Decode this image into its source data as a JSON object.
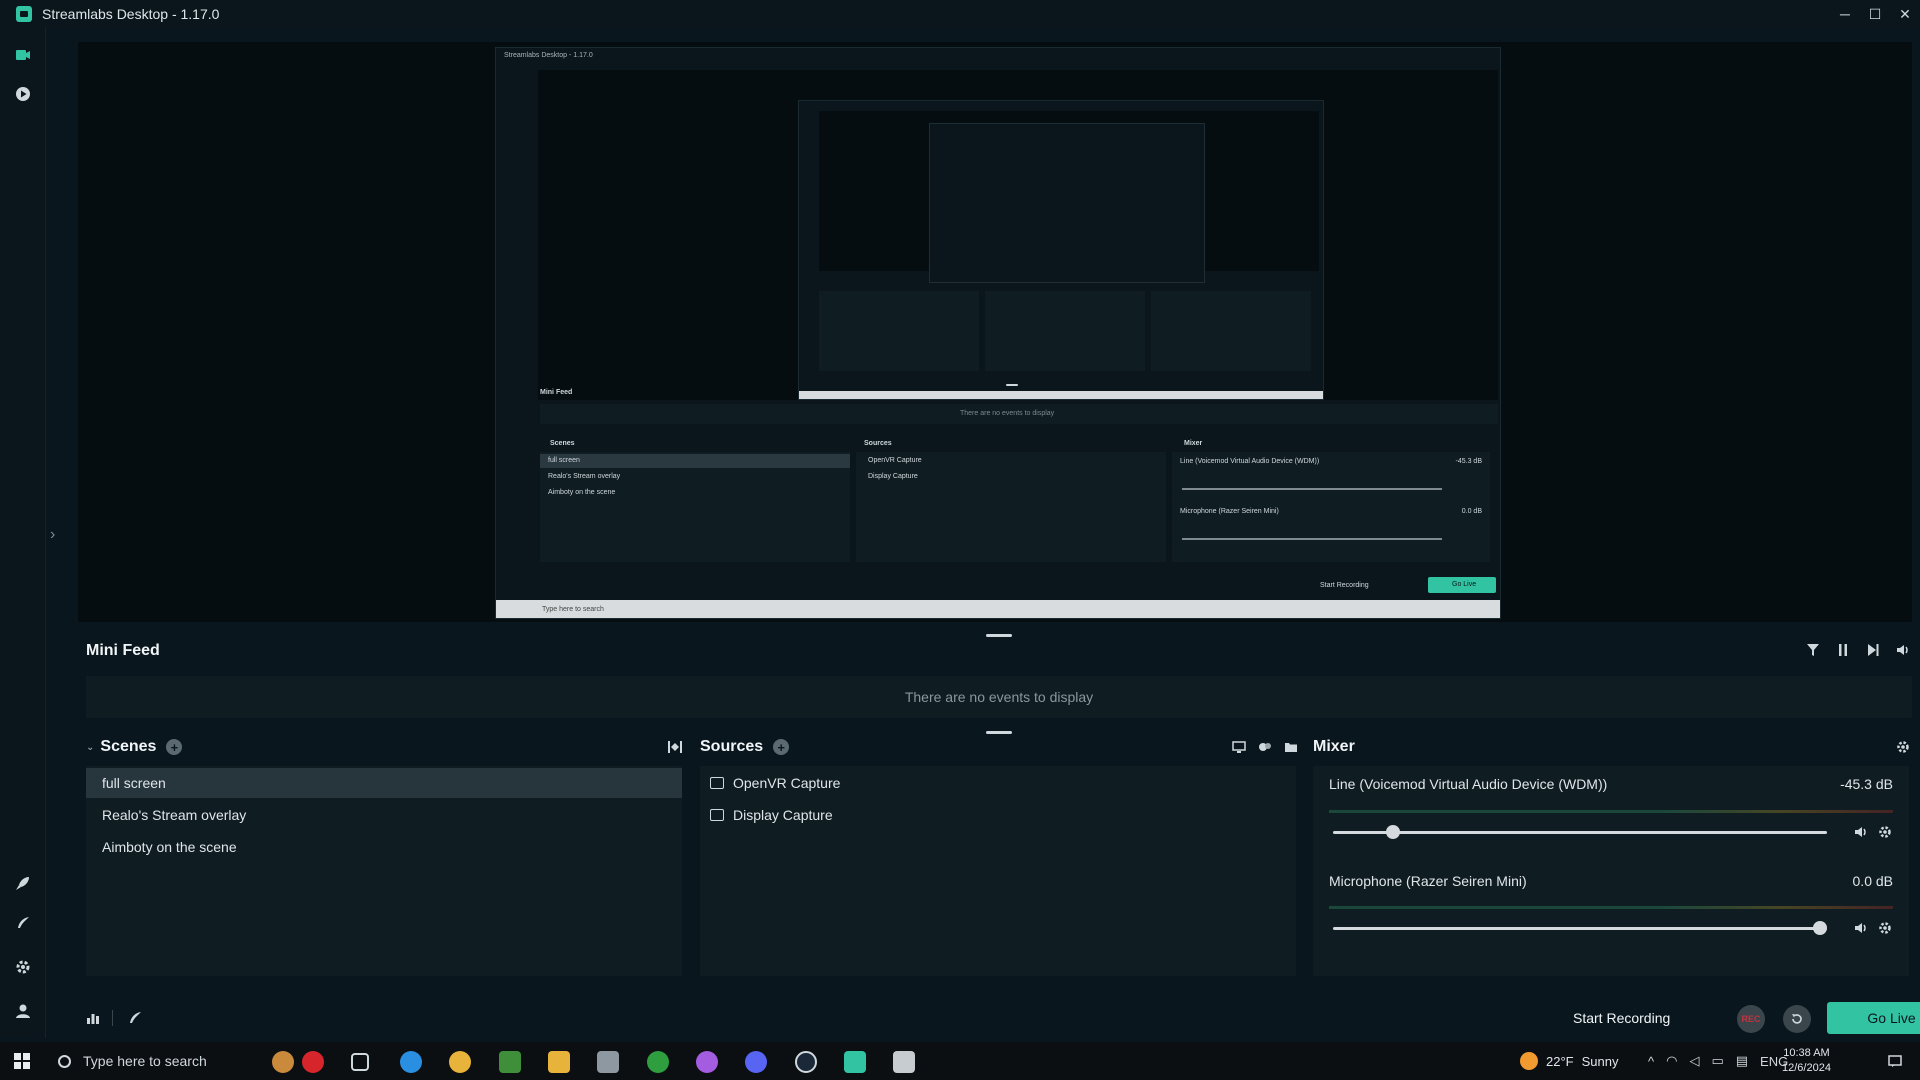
{
  "window": {
    "title": "Streamlabs Desktop - 1.17.0",
    "minimize": "─",
    "maximize": "☐",
    "close": "✕"
  },
  "sidebar": {
    "icons": [
      "editor-icon",
      "play-icon",
      "rocket-icon",
      "feather-icon",
      "gear-icon",
      "user-icon"
    ]
  },
  "mini_feed": {
    "title": "Mini Feed",
    "empty_text": "There are no events to display"
  },
  "scenes": {
    "title": "Scenes",
    "items": [
      "full screen",
      "Realo's Stream overlay",
      "Aimboty on the scene"
    ],
    "active_index": 0
  },
  "sources": {
    "title": "Sources",
    "items": [
      "OpenVR Capture",
      "Display Capture"
    ]
  },
  "mixer": {
    "title": "Mixer",
    "channels": [
      {
        "name": "Line (Voicemod Virtual Audio Device (WDM))",
        "db": "-45.3 dB",
        "volume": 0.11
      },
      {
        "name": "Microphone (Razer Seiren Mini)",
        "db": "0.0 dB",
        "volume": 1.0
      }
    ]
  },
  "footer": {
    "start_recording": "Start Recording",
    "rec": "REC",
    "go_live": "Go Live"
  },
  "preview": {
    "title": "Streamlabs Desktop - 1.17.0",
    "mini_feed": "Mini Feed",
    "empty_text": "There are no events to display",
    "scenes": "Scenes",
    "sources": "Sources",
    "mixer": "Mixer",
    "scene_items": [
      "full screen",
      "Realo's Stream overlay",
      "Aimboty on the scene"
    ],
    "source_items": [
      "OpenVR Capture",
      "Display Capture"
    ],
    "channel_names": [
      "Line (Voicemod Virtual Audio Device (WDM))",
      "Microphone (Razer Seiren Mini)"
    ],
    "channel_db": [
      "-45.3 dB",
      "0.0 dB"
    ],
    "start_recording": "Start Recording",
    "go_live": "Go Live",
    "search": "Type here to search"
  },
  "taskbar": {
    "search_placeholder": "Type here to search",
    "weather_temp": "22°F",
    "weather_text": "Sunny",
    "language": "ENG",
    "time": "10:38 AM",
    "date": "12/6/2024"
  },
  "colors": {
    "accent": "#31c3a2",
    "background": "#09161d",
    "panel": "#0f1c22",
    "record_red": "#c3333f"
  }
}
